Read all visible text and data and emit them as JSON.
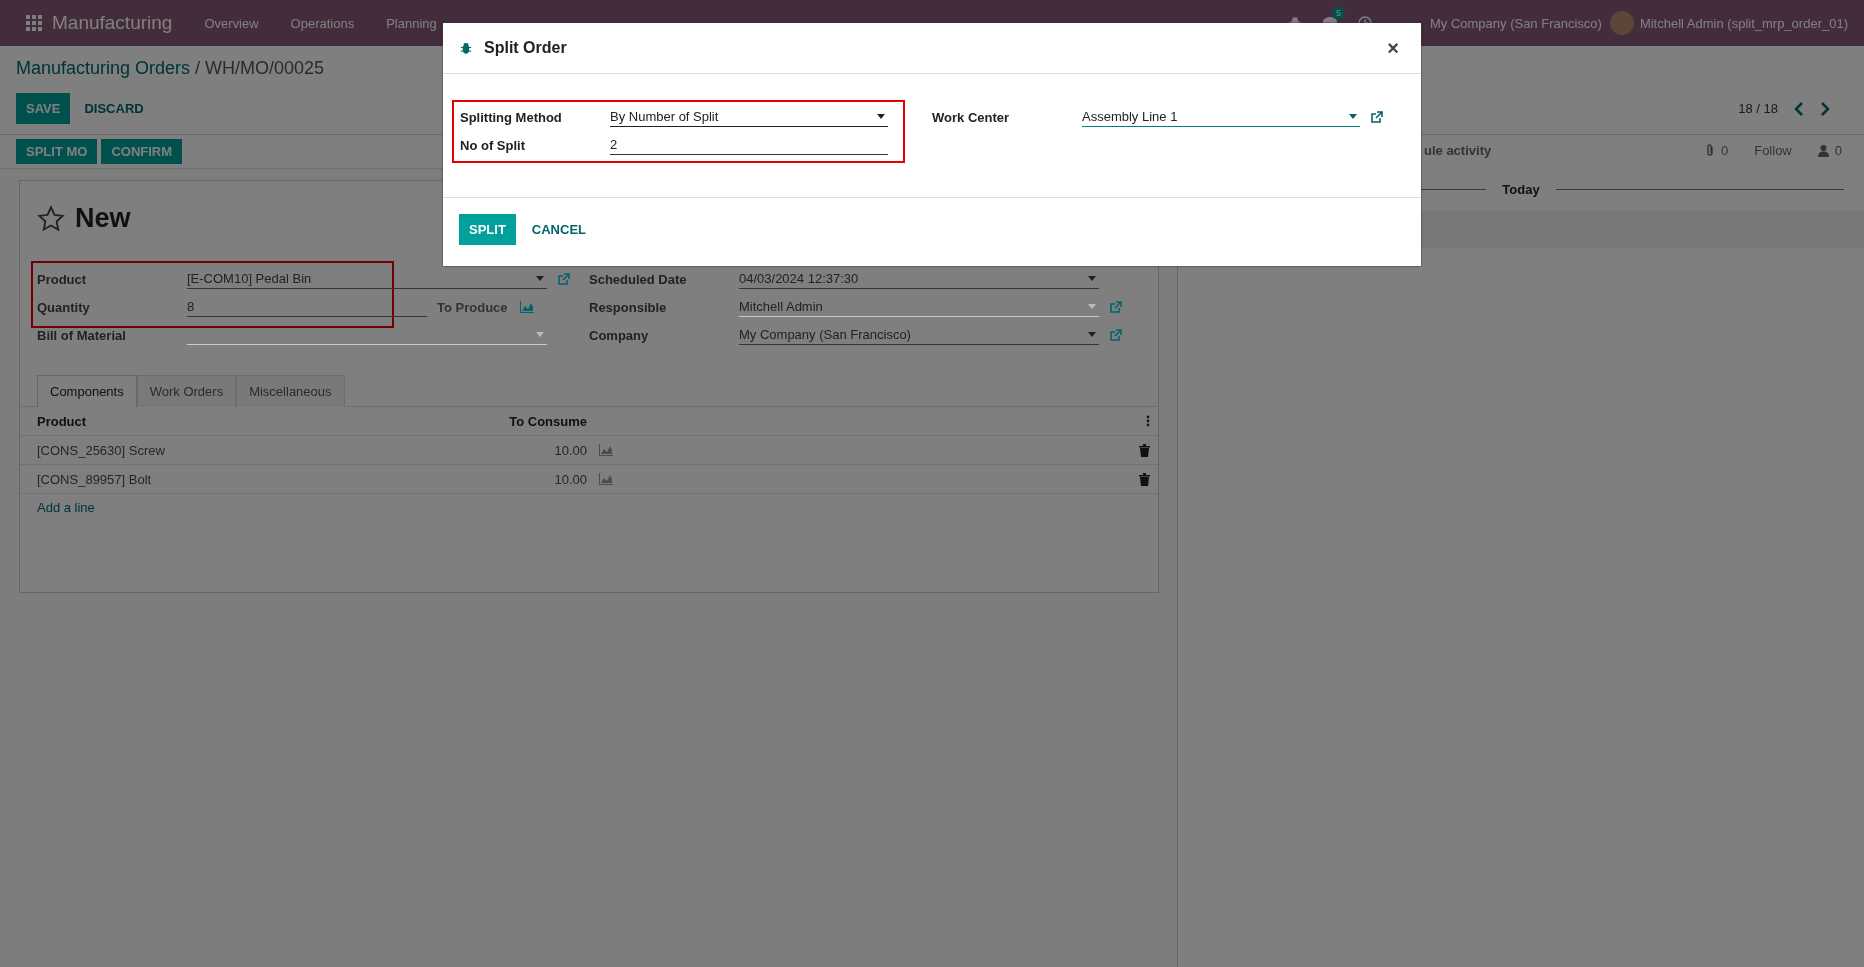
{
  "navbar": {
    "app": "Manufacturing",
    "menu": [
      "Overview",
      "Operations",
      "Planning"
    ],
    "message_count": "5",
    "company": "My Company (San Francisco)",
    "user": "Mitchell Admin (split_mrp_order_01)"
  },
  "breadcrumb": {
    "parent": "Manufacturing Orders",
    "separator": "/",
    "current": "WH/MO/00025"
  },
  "actions": [
    {
      "label": "SAVE",
      "kind": "primary"
    },
    {
      "label": "DISCARD",
      "kind": "link"
    }
  ],
  "pager": "18 / 18",
  "status_buttons": [
    "SPLIT MO",
    "CONFIRM"
  ],
  "chatter": {
    "activity": "ule activity",
    "attachments": "0",
    "follow": "Follow",
    "followers": "0",
    "separator": "Today"
  },
  "form": {
    "title": "New",
    "starred": false,
    "left_groups": [
      {
        "highlighted": true,
        "fields": [
          {
            "label": "Product",
            "value": "[E-COM10] Pedal Bin",
            "kind": "select",
            "disabled": false,
            "link": true
          },
          {
            "label": "Quantity",
            "value": "8",
            "kind": "quantity",
            "unit": "To Produce"
          }
        ]
      },
      {
        "highlighted": false,
        "fields": [
          {
            "label": "Bill of Material",
            "kind": "select",
            "disabled": true,
            "link": false
          }
        ]
      }
    ],
    "right_fields": [
      {
        "label": "Scheduled Date",
        "value": "04/03/2024 12:37:30",
        "kind": "select",
        "disabled": false,
        "link": false
      },
      {
        "label": "Responsible",
        "value": "Mitchell Admin",
        "kind": "select",
        "disabled": true,
        "link": true
      },
      {
        "label": "Company",
        "value": "My Company (San Francisco)",
        "kind": "select",
        "disabled": false,
        "link": true
      }
    ],
    "tabs": [
      {
        "label": "Components",
        "selected": true
      },
      {
        "label": "Work Orders",
        "selected": false
      },
      {
        "label": "Miscellaneous",
        "selected": false
      }
    ],
    "table": {
      "columns": [
        "Product",
        "To Consume"
      ],
      "rows": [
        {
          "product": "[CONS_25630] Screw",
          "quantity": "10.00"
        },
        {
          "product": "[CONS_89957] Bolt",
          "quantity": "10.00"
        }
      ],
      "add_line": "Add a line"
    }
  },
  "dialog": {
    "title": "Split Order",
    "close": "×",
    "left_group": {
      "highlighted": true,
      "fields": [
        {
          "label": "Splitting Method",
          "value": "By Number of Split",
          "kind": "select",
          "link": false
        },
        {
          "label": "No of Split",
          "value": "2",
          "kind": "text",
          "link": false
        }
      ]
    },
    "right_fields": [
      {
        "label": "Work Center",
        "value": "Assembly Line 1",
        "kind": "select",
        "link": true
      }
    ],
    "buttons": [
      {
        "label": "SPLIT",
        "kind": "primary"
      },
      {
        "label": "CANCEL",
        "kind": "link"
      }
    ]
  }
}
